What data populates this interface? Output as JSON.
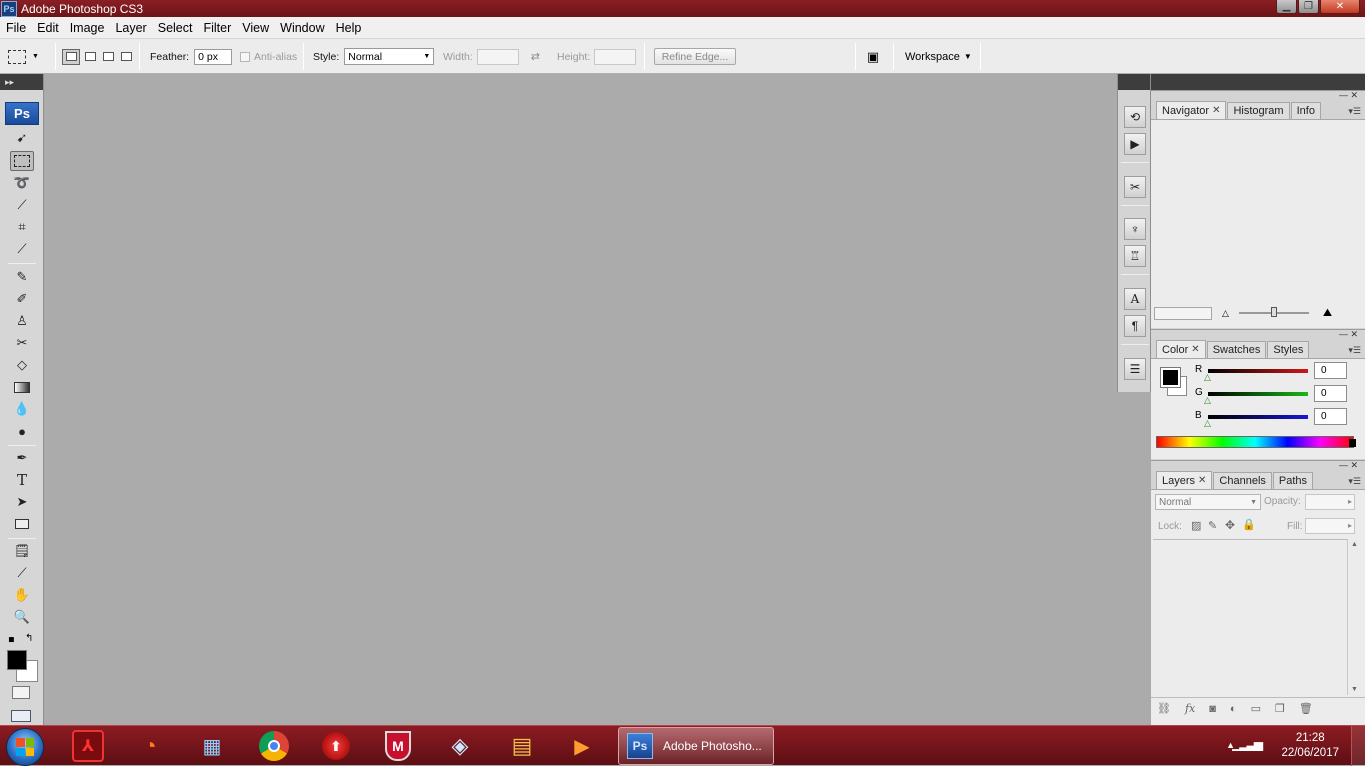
{
  "window": {
    "title": "Adobe Photoshop CS3",
    "app_icon": "Ps"
  },
  "menu": [
    "File",
    "Edit",
    "Image",
    "Layer",
    "Select",
    "Filter",
    "View",
    "Window",
    "Help"
  ],
  "options": {
    "feather_label": "Feather:",
    "feather_value": "0 px",
    "antialias_label": "Anti-alias",
    "style_label": "Style:",
    "style_value": "Normal",
    "width_label": "Width:",
    "height_label": "Height:",
    "refine_edge": "Refine Edge...",
    "workspace": "Workspace"
  },
  "toolbox": {
    "badge": "Ps"
  },
  "panels": {
    "group1": {
      "tabs": [
        "Navigator",
        "Histogram",
        "Info"
      ]
    },
    "group2": {
      "tabs": [
        "Color",
        "Swatches",
        "Styles"
      ],
      "channels": [
        {
          "label": "R",
          "value": "0",
          "color": "#d01818"
        },
        {
          "label": "G",
          "value": "0",
          "color": "#18b818"
        },
        {
          "label": "B",
          "value": "0",
          "color": "#1818d0"
        }
      ]
    },
    "group3": {
      "tabs": [
        "Layers",
        "Channels",
        "Paths"
      ],
      "blend_mode": "Normal",
      "opacity_label": "Opacity:",
      "lock_label": "Lock:",
      "fill_label": "Fill:"
    }
  },
  "taskbar": {
    "active_app_label": "Adobe Photosho...",
    "active_app_icon": "Ps",
    "clock_time": "21:28",
    "clock_date": "22/06/2017"
  },
  "colors": {
    "title_bar": "#7a171c",
    "canvas": "#ababab",
    "taskbar": "#6e1218",
    "accent_ps": "#1a4b9a"
  }
}
